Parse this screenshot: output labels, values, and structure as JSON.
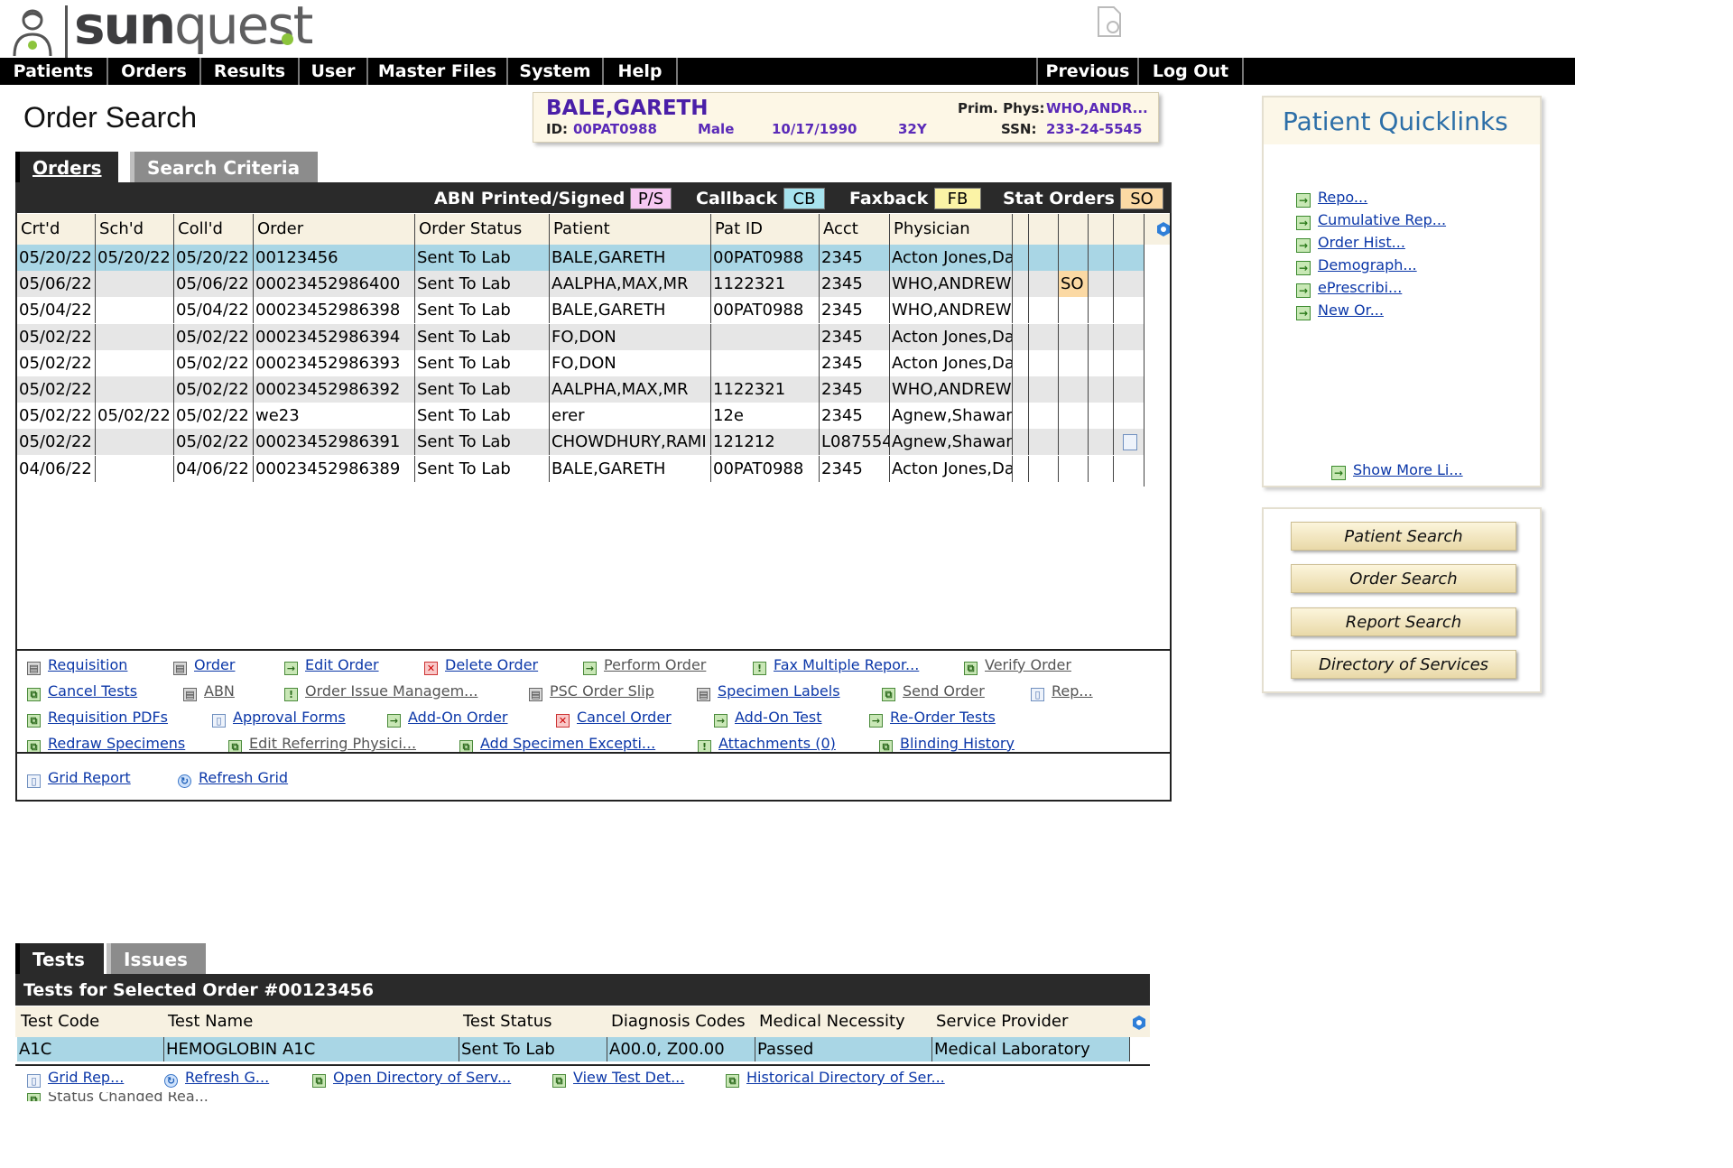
{
  "header": {
    "logo_text_bold": "sun",
    "logo_text_light": "quest"
  },
  "menu": {
    "items": [
      "Patients",
      "Orders",
      "Results",
      "User",
      "Master Files",
      "System",
      "Help"
    ],
    "previous": "Previous",
    "logout": "Log Out"
  },
  "page_title": "Order Search",
  "patient_banner": {
    "name": "BALE,GARETH",
    "id_label": "ID:",
    "id": "00PAT0988",
    "sex": "Male",
    "dob": "10/17/1990",
    "age": "32Y",
    "prim_phys_label": "Prim. Phys:",
    "prim_phys": "WHO,ANDR...",
    "ssn_label": "SSN:",
    "ssn": "233-24-5545"
  },
  "tabs": {
    "orders": "Orders",
    "search_criteria": "Search Criteria"
  },
  "legend": {
    "abn_label": "ABN Printed/Signed",
    "abn_code": "P/S",
    "abn_color": "#f6c7f2",
    "callback_label": "Callback",
    "callback_code": "CB",
    "callback_color": "#a7e3ee",
    "faxback_label": "Faxback",
    "faxback_code": "FB",
    "faxback_color": "#fbf3a6",
    "stat_label": "Stat Orders",
    "stat_code": "SO",
    "stat_color": "#fbd9a4"
  },
  "orders_grid": {
    "columns": [
      "Crt'd",
      "Sch'd",
      "Coll'd",
      "Order",
      "Order Status",
      "Patient",
      "Pat ID",
      "Acct",
      "Physician"
    ],
    "rows": [
      {
        "crtd": "05/20/22",
        "schd": "05/20/22",
        "colld": "05/20/22",
        "order": "00123456",
        "status": "Sent To Lab",
        "patient": "BALE,GARETH",
        "patid": "00PAT0988",
        "acct": "2345",
        "physician": "Acton Jones,Da",
        "flag": "",
        "selected": true
      },
      {
        "crtd": "05/06/22",
        "schd": "",
        "colld": "05/06/22",
        "order": "00023452986400",
        "status": "Sent To Lab",
        "patient": "AALPHA,MAX,MR",
        "patid": "1122321",
        "acct": "2345",
        "physician": "WHO,ANDREW",
        "flag": "SO",
        "selected": false
      },
      {
        "crtd": "05/04/22",
        "schd": "",
        "colld": "05/04/22",
        "order": "00023452986398",
        "status": "Sent To Lab",
        "patient": "BALE,GARETH",
        "patid": "00PAT0988",
        "acct": "2345",
        "physician": "WHO,ANDREW",
        "flag": "",
        "selected": false
      },
      {
        "crtd": "05/02/22",
        "schd": "",
        "colld": "05/02/22",
        "order": "00023452986394",
        "status": "Sent To Lab",
        "patient": "FO,DON",
        "patid": "",
        "acct": "2345",
        "physician": "Acton Jones,Da",
        "flag": "",
        "selected": false
      },
      {
        "crtd": "05/02/22",
        "schd": "",
        "colld": "05/02/22",
        "order": "00023452986393",
        "status": "Sent To Lab",
        "patient": "FO,DON",
        "patid": "",
        "acct": "2345",
        "physician": "Acton Jones,Da",
        "flag": "",
        "selected": false
      },
      {
        "crtd": "05/02/22",
        "schd": "",
        "colld": "05/02/22",
        "order": "00023452986392",
        "status": "Sent To Lab",
        "patient": "AALPHA,MAX,MR",
        "patid": "1122321",
        "acct": "2345",
        "physician": "WHO,ANDREW",
        "flag": "",
        "selected": false
      },
      {
        "crtd": "05/02/22",
        "schd": "05/02/22",
        "colld": "05/02/22",
        "order": "we23",
        "status": "Sent To Lab",
        "patient": "erer",
        "patid": "12e",
        "acct": "2345",
        "physician": "Agnew,Shawar",
        "flag": "",
        "selected": false
      },
      {
        "crtd": "05/02/22",
        "schd": "",
        "colld": "05/02/22",
        "order": "00023452986391",
        "status": "Sent To Lab",
        "patient": "CHOWDHURY,RAMI",
        "patid": "121212",
        "acct": "L087554",
        "physician": "Agnew,Shawar",
        "flag": "",
        "selected": false
      },
      {
        "crtd": "04/06/22",
        "schd": "",
        "colld": "04/06/22",
        "order": "00023452986389",
        "status": "Sent To Lab",
        "patient": "BALE,GARETH",
        "patid": "00PAT0988",
        "acct": "2345",
        "physician": "Acton Jones,Da",
        "flag": "",
        "selected": false
      }
    ]
  },
  "actions": {
    "requisition": "Requisition",
    "order": "Order",
    "edit_order": "Edit Order",
    "delete_order": "Delete Order",
    "perform_order": "Perform Order",
    "fax_multiple": "Fax Multiple Repor...",
    "verify_order": "Verify Order",
    "cancel_tests": "Cancel Tests",
    "abn": "ABN",
    "order_issue": "Order Issue Managem...",
    "psc_slip": "PSC Order Slip",
    "specimen_labels": "Specimen Labels",
    "send_order": "Send Order",
    "rep": "Rep...",
    "requisition_pdfs": "Requisition PDFs",
    "approval_forms": "Approval Forms",
    "add_on_order": "Add-On Order",
    "cancel_order": "Cancel Order",
    "add_on_test": "Add-On Test",
    "re_order_tests": "Re-Order Tests",
    "redraw_specimens": "Redraw Specimens",
    "edit_referring": "Edit Referring Physici...",
    "add_specimen_exception": "Add Specimen Excepti...",
    "attachments": "Attachments (0)",
    "blinding_history": "Blinding History",
    "grid_report": "Grid Report",
    "refresh_grid": "Refresh Grid"
  },
  "quicklinks": {
    "title": "Patient Quicklinks",
    "items": [
      "Repo...",
      "Cumulative Rep...",
      "Order Hist...",
      "Demograph...",
      "ePrescribi...",
      "New Or..."
    ],
    "show_more": "Show More Li..."
  },
  "search_buttons": [
    "Patient Search",
    "Order Search",
    "Report Search",
    "Directory of Services"
  ],
  "tests": {
    "tab_tests": "Tests",
    "tab_issues": "Issues",
    "title": "Tests for Selected Order #00123456",
    "columns": [
      "Test Code",
      "Test Name",
      "Test Status",
      "Diagnosis Codes",
      "Medical Necessity",
      "Service Provider"
    ],
    "row": {
      "code": "A1C",
      "name": "HEMOGLOBIN A1C",
      "status": "Sent To Lab",
      "dx": "A00.0, Z00.00",
      "necessity": "Passed",
      "provider": "Medical Laboratory"
    },
    "actions": {
      "grid_rep": "Grid Rep...",
      "refresh_g": "Refresh G...",
      "open_dos": "Open Directory of Serv...",
      "view_test": "View Test Det...",
      "historical_dos": "Historical Directory of Ser...",
      "status_changed": "Status Changed Rea..."
    }
  }
}
